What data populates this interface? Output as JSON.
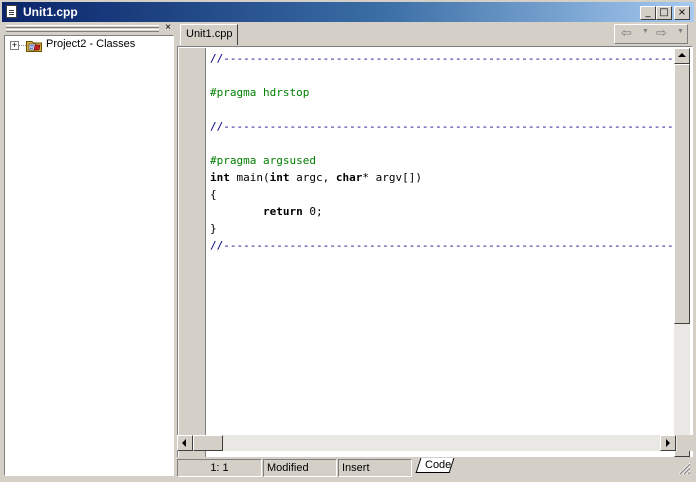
{
  "window": {
    "title": "Unit1.cpp",
    "buttons": {
      "minimize": "_",
      "maximize": "□",
      "close": "×"
    }
  },
  "class_explorer": {
    "close_glyph": "×",
    "expander": "+",
    "tree": [
      {
        "label": "Project2 - Classes",
        "icon": "classes-folder-icon"
      }
    ]
  },
  "editor": {
    "tabs": [
      {
        "label": "Unit1.cpp"
      }
    ],
    "nav": {
      "back": "⇦",
      "forward": "⇨",
      "dropdown": "▼"
    },
    "lines": [
      [
        {
          "t": "//----------------------------------------------------------------------------",
          "c": "comment"
        }
      ],
      [],
      [
        {
          "t": "#pragma hdrstop",
          "c": "directive"
        }
      ],
      [],
      [
        {
          "t": "//----------------------------------------------------------------------------",
          "c": "comment"
        }
      ],
      [],
      [
        {
          "t": "#pragma argsused",
          "c": "directive"
        }
      ],
      [
        {
          "t": "int",
          "c": "kw"
        },
        {
          "t": " main(",
          "c": ""
        },
        {
          "t": "int",
          "c": "kw"
        },
        {
          "t": " argc, ",
          "c": ""
        },
        {
          "t": "char",
          "c": "kw"
        },
        {
          "t": "* argv[])",
          "c": ""
        }
      ],
      [
        {
          "t": "{",
          "c": ""
        }
      ],
      [
        {
          "t": "        ",
          "c": ""
        },
        {
          "t": "return",
          "c": "kw"
        },
        {
          "t": " 0;",
          "c": ""
        }
      ],
      [
        {
          "t": "}",
          "c": ""
        }
      ],
      [
        {
          "t": "//----------------------------------------------------------------------------",
          "c": "comment"
        }
      ]
    ],
    "colors": {
      "comment": "#000080",
      "directive": "#008000",
      "text": "#000000",
      "titlebar": "#0a246a"
    }
  },
  "status": {
    "position": "1:   1",
    "modified": "Modified",
    "mode": "Insert",
    "view_tab": "Code"
  }
}
